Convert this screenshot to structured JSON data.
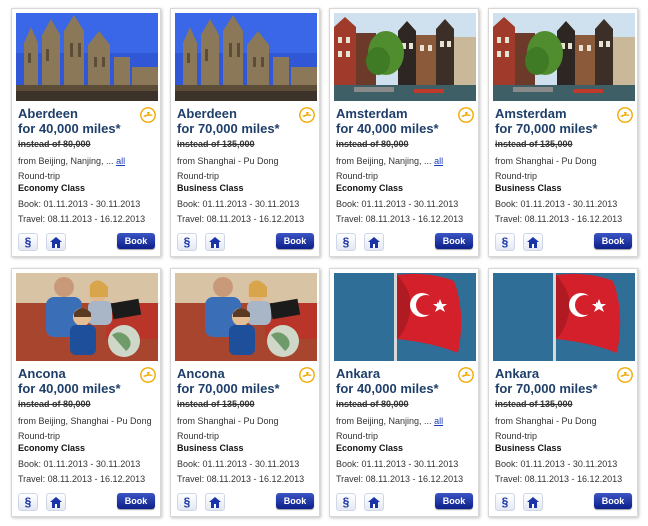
{
  "cards": [
    {
      "city": "Aberdeen",
      "miles": "for 40,000 miles*",
      "instead": "instead of 80,000",
      "from": "from Beijing, Nanjing, ...",
      "all_link": "all",
      "trip": "Round-trip",
      "class": "Economy Class",
      "book": "Book: 01.11.2013 - 30.11.2013",
      "travel": "Travel: 08.11.2013 - 16.12.2013",
      "photo": "cathedral-photo",
      "book_label": "Book",
      "par_label": "§"
    },
    {
      "city": "Aberdeen",
      "miles": "for 70,000 miles*",
      "instead": "instead of 135,000",
      "from": "from Shanghai - Pu Dong",
      "all_link": "",
      "trip": "Round-trip",
      "class": "Business Class",
      "book": "Book: 01.11.2013 - 30.11.2013",
      "travel": "Travel: 08.11.2013 - 16.12.2013",
      "photo": "cathedral-photo",
      "book_label": "Book",
      "par_label": "§"
    },
    {
      "city": "Amsterdam",
      "miles": "for 40,000 miles*",
      "instead": "instead of 80,000",
      "from": "from Beijing, Nanjing, ...",
      "all_link": "all",
      "trip": "Round-trip",
      "class": "Economy Class",
      "book": "Book: 01.11.2013 - 30.11.2013",
      "travel": "Travel: 08.11.2013 - 16.12.2013",
      "photo": "canal-photo",
      "book_label": "Book",
      "par_label": "§"
    },
    {
      "city": "Amsterdam",
      "miles": "for 70,000 miles*",
      "instead": "instead of 135,000",
      "from": "from Shanghai - Pu Dong",
      "all_link": "",
      "trip": "Round-trip",
      "class": "Business Class",
      "book": "Book: 01.11.2013 - 30.11.2013",
      "travel": "Travel: 08.11.2013 - 16.12.2013",
      "photo": "canal-photo",
      "book_label": "Book",
      "par_label": "§"
    },
    {
      "city": "Ancona",
      "miles": "for 40,000 miles*",
      "instead": "instead of 80,000",
      "from": "from Beijing, Shanghai - Pu Dong",
      "all_link": "",
      "trip": "Round-trip",
      "class": "Economy Class",
      "book": "Book: 01.11.2013 - 30.11.2013",
      "travel": "Travel: 08.11.2013 - 16.12.2013",
      "photo": "family-photo",
      "book_label": "Book",
      "par_label": "§"
    },
    {
      "city": "Ancona",
      "miles": "for 70,000 miles*",
      "instead": "instead of 135,000",
      "from": "from Shanghai - Pu Dong",
      "all_link": "",
      "trip": "Round-trip",
      "class": "Business Class",
      "book": "Book: 01.11.2013 - 30.11.2013",
      "travel": "Travel: 08.11.2013 - 16.12.2013",
      "photo": "family-photo",
      "book_label": "Book",
      "par_label": "§"
    },
    {
      "city": "Ankara",
      "miles": "for 40,000 miles*",
      "instead": "instead of 80,000",
      "from": "from Beijing, Nanjing, ...",
      "all_link": "all",
      "trip": "Round-trip",
      "class": "Economy Class",
      "book": "Book: 01.11.2013 - 30.11.2013",
      "travel": "Travel: 08.11.2013 - 16.12.2013",
      "photo": "flag-photo",
      "book_label": "Book",
      "par_label": "§"
    },
    {
      "city": "Ankara",
      "miles": "for 70,000 miles*",
      "instead": "instead of 135,000",
      "from": "from Shanghai - Pu Dong",
      "all_link": "",
      "trip": "Round-trip",
      "class": "Business Class",
      "book": "Book: 01.11.2013 - 30.11.2013",
      "travel": "Travel: 08.11.2013 - 16.12.2013",
      "photo": "flag-photo",
      "book_label": "Book",
      "par_label": "§"
    }
  ],
  "colors": {
    "title": "#1f3f6a",
    "book_button": "#0c1f8a",
    "link": "#1a3cb8",
    "logo": "#f2a900"
  }
}
